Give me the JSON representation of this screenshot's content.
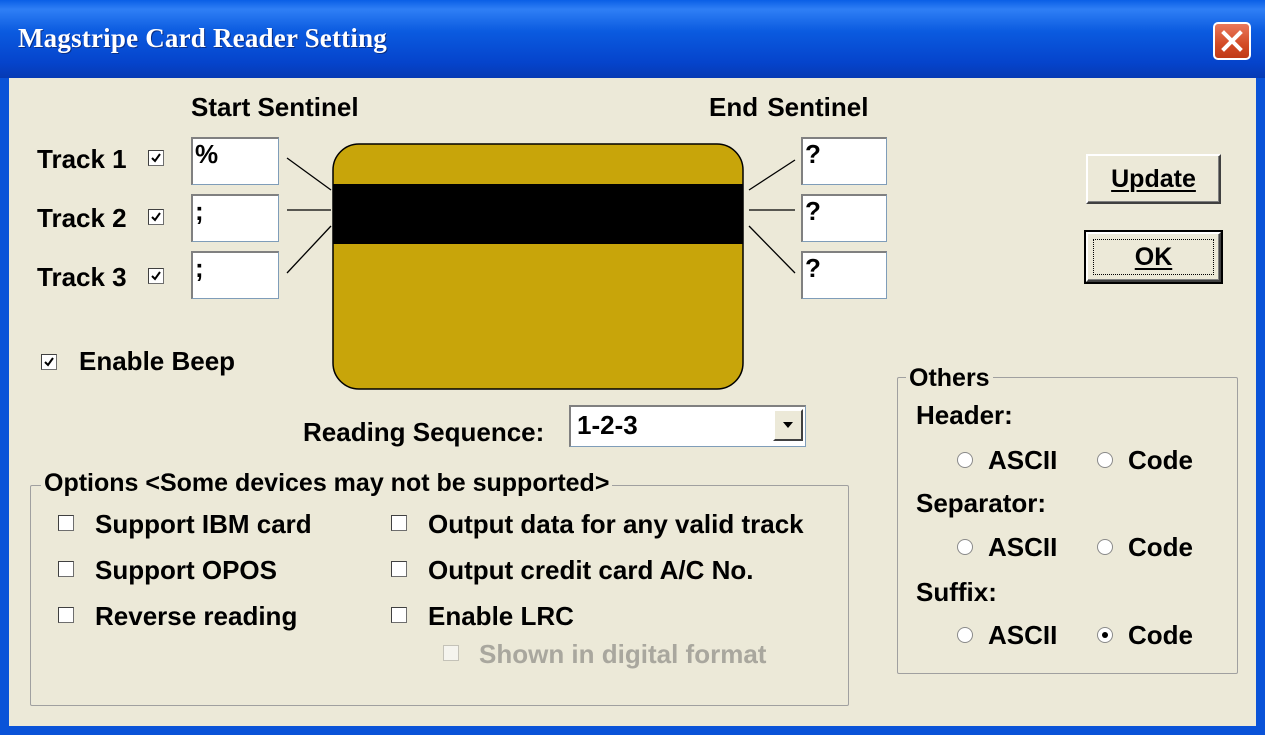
{
  "window": {
    "title": "Magstripe Card Reader Setting"
  },
  "sentinels": {
    "start_label": "Start Sentinel",
    "end_label": "End  Sentinel",
    "tracks": [
      {
        "label": "Track 1",
        "checked": true,
        "start": "%",
        "end": "?"
      },
      {
        "label": "Track 2",
        "checked": true,
        "start": ";",
        "end": "?"
      },
      {
        "label": "Track 3",
        "checked": true,
        "start": ";",
        "end": "?"
      }
    ]
  },
  "card": {
    "body_color": "#c8a50a",
    "stripe_color": "#000000"
  },
  "enable_beep": {
    "label": "Enable Beep",
    "checked": true
  },
  "reading_sequence": {
    "label": "Reading Sequence:",
    "value": "1-2-3"
  },
  "buttons": {
    "update": "Update",
    "ok": "OK"
  },
  "options": {
    "title": "Options <Some devices may not be supported>",
    "items": [
      {
        "label": "Support IBM card",
        "checked": false
      },
      {
        "label": "Support OPOS",
        "checked": false
      },
      {
        "label": "Reverse reading",
        "checked": false
      },
      {
        "label": "Output data for any valid track",
        "checked": false
      },
      {
        "label": "Output credit card A/C No.",
        "checked": false
      },
      {
        "label": "Enable LRC",
        "checked": false
      },
      {
        "label": "Shown in digital format",
        "checked": false,
        "disabled": true
      }
    ]
  },
  "others": {
    "title": "Others",
    "header": {
      "label": "Header:",
      "ascii": "ASCII",
      "code": "Code",
      "selected": "none"
    },
    "separator": {
      "label": "Separator:",
      "ascii": "ASCII",
      "code": "Code",
      "selected": "none"
    },
    "suffix": {
      "label": "Suffix:",
      "ascii": "ASCII",
      "code": "Code",
      "selected": "Code"
    }
  }
}
